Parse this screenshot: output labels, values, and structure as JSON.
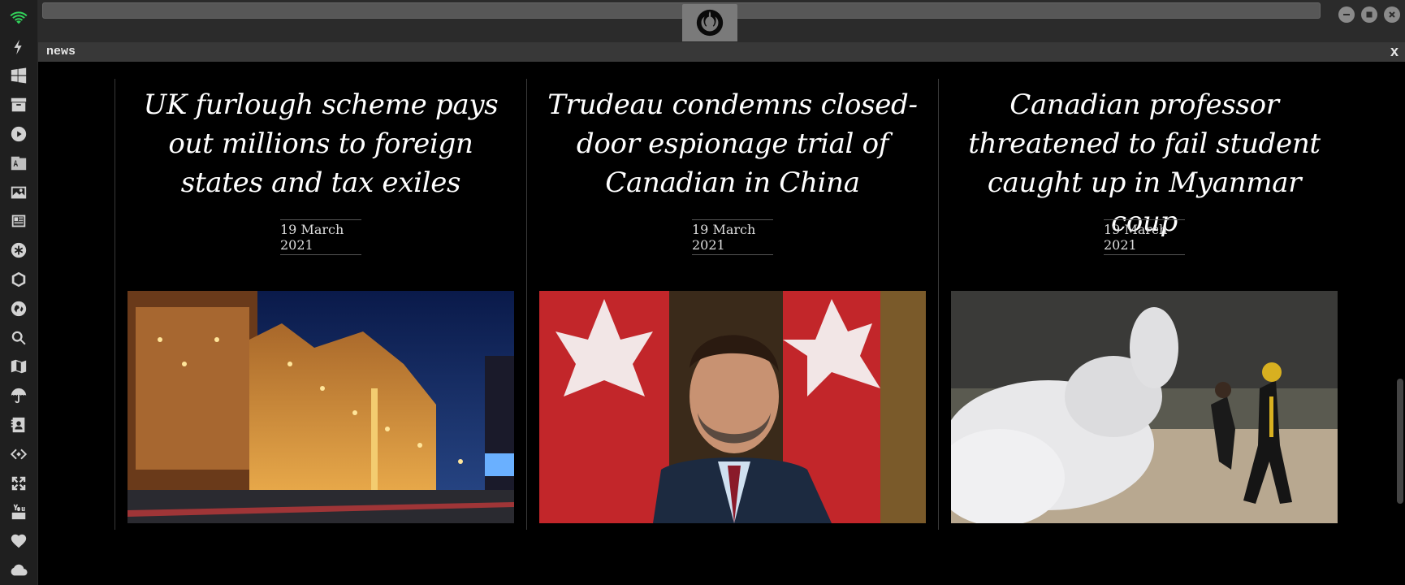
{
  "window": {
    "tab_title": "news",
    "close_label": "x"
  },
  "dock": {
    "icons": [
      "wifi-icon",
      "lightning-icon",
      "windows-icon",
      "archive-icon",
      "play-icon",
      "translate-icon",
      "image-icon",
      "newspaper-icon",
      "snowflake-icon",
      "hexagon-icon",
      "globe-icon",
      "search-icon",
      "map-icon",
      "umbrella-icon",
      "contacts-icon",
      "code-icon",
      "expand-icon",
      "youtube-icon",
      "heart-icon",
      "cloud-icon"
    ],
    "active_color": "#32d35b"
  },
  "articles": [
    {
      "headline": "UK furlough scheme pays out millions to foreign states and tax exiles",
      "date": "19 March 2021",
      "image": "harrods-night-photo"
    },
    {
      "headline": "Trudeau condemns closed-door espionage trial of Canadian in China",
      "date": "19 March 2021",
      "image": "trudeau-photo"
    },
    {
      "headline": "Canadian professor threatened to fail student caught up in Myanmar coup",
      "date": "19 March 2021",
      "image": "myanmar-protest-photo"
    }
  ]
}
